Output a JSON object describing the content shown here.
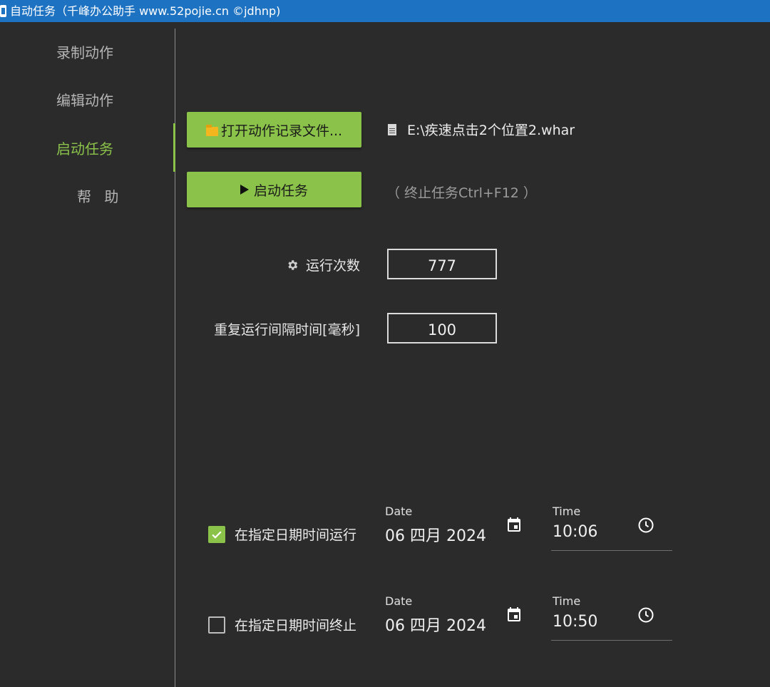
{
  "window": {
    "title": "自动任务（千峰办公助手 www.52pojie.cn ©jdhnp)"
  },
  "sidebar": {
    "items": [
      {
        "label": "录制动作"
      },
      {
        "label": "编辑动作"
      },
      {
        "label": "启动任务"
      },
      {
        "label": "帮 助"
      }
    ],
    "active_index": 2
  },
  "main": {
    "open_file_button": "打开动作记录文件...",
    "file_path": "E:\\疾速点击2个位置2.whar",
    "start_button": "启动任务",
    "stop_hint": "（ 终止任务Ctrl+F12 ）",
    "run_count": {
      "label": "运行次数",
      "value": "777"
    },
    "interval": {
      "label": "重复运行间隔时间[毫秒]",
      "value": "100"
    },
    "schedule_start": {
      "checkbox_label": "在指定日期时间运行",
      "checked": true,
      "date_caption": "Date",
      "date_value": "06 四月 2024",
      "time_caption": "Time",
      "time_value": "10:06"
    },
    "schedule_stop": {
      "checkbox_label": "在指定日期时间终止",
      "checked": false,
      "date_caption": "Date",
      "date_value": "06 四月 2024",
      "time_caption": "Time",
      "time_value": "10:50"
    }
  },
  "icons": {
    "app": "app-icon",
    "open_file": "folder-icon",
    "file": "file-icon",
    "start": "play-icon",
    "run_count": "gear-icon",
    "checkbox_checked": "check-icon",
    "date": "calendar-icon",
    "time": "clock-icon"
  },
  "colors": {
    "accent": "#8bc34a",
    "titlebar": "#1d72c2",
    "background": "#2b2b2b"
  }
}
